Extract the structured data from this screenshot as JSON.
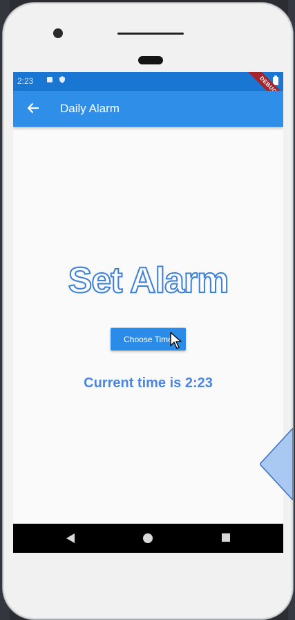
{
  "status_bar": {
    "time": "2:23"
  },
  "debug_banner": "DEBUG",
  "app_bar": {
    "title": "Daily Alarm",
    "back_icon": "arrow-left-icon"
  },
  "main": {
    "heading": "Set Alarm",
    "choose_button_label": "Choose Time",
    "current_time_text": "Current time is 2:23"
  },
  "nav_bar": {
    "icons": [
      "back-triangle-icon",
      "home-circle-icon",
      "recents-square-icon"
    ]
  },
  "colors": {
    "status_bar": "#1976d2",
    "app_bar": "#2f8fe8",
    "accent_text": "#4a86df",
    "button": "#2b8ce8"
  }
}
